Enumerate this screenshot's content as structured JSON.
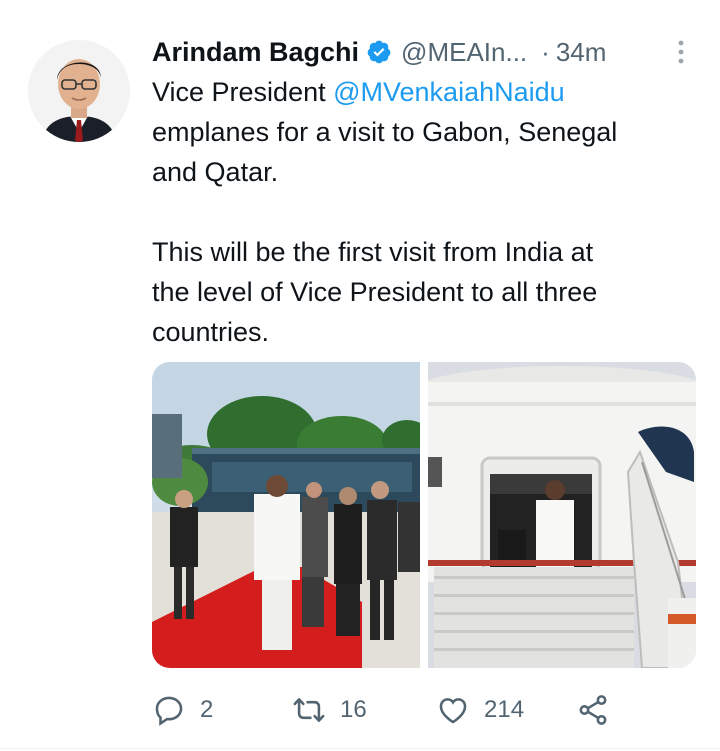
{
  "author": {
    "name": "Arindam Bagchi",
    "handle": "@MEAIn...",
    "separator": "·",
    "time": "34m",
    "verified": true,
    "avatar_icon": "person-avatar"
  },
  "tweet": {
    "line1_prefix": "Vice President ",
    "mention": "@MVenkaiahNaidu",
    "line2": "emplanes for a visit to Gabon, Senegal",
    "line3": "and Qatar.",
    "line4": "This will be the first visit from India at",
    "line5": "the level of Vice President to all three",
    "line6": "countries."
  },
  "media": [
    {
      "icon": "photo-airport-walk"
    },
    {
      "icon": "photo-aircraft-door"
    }
  ],
  "actions": {
    "replies": "2",
    "retweets": "16",
    "likes": "214"
  },
  "colors": {
    "link": "#1d9bf0",
    "secondary_text": "#536471",
    "verified_badge": "#1d9bf0"
  }
}
